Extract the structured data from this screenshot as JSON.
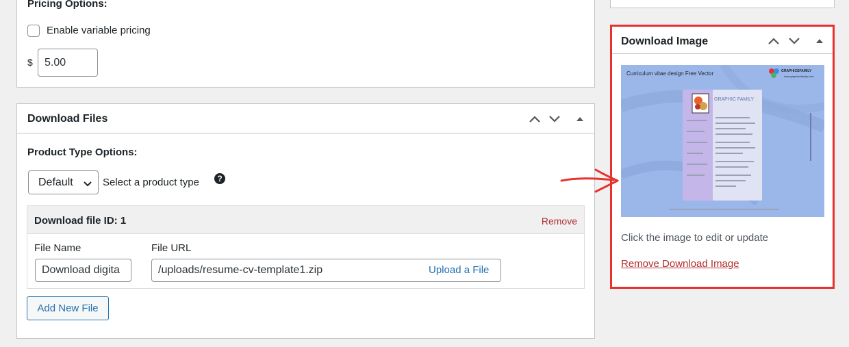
{
  "pricing": {
    "title": "Pricing Options:",
    "variable_pricing_label": "Enable variable pricing",
    "currency_symbol": "$",
    "price_value": "5.00"
  },
  "download_files": {
    "title": "Download Files",
    "product_type_label": "Product Type Options:",
    "product_type_select": "Default",
    "product_type_hint": "Select a product type",
    "file_row": {
      "header": "Download file ID: 1",
      "remove_label": "Remove",
      "file_name_label": "File Name",
      "file_name_value": "Download digita",
      "file_url_label": "File URL",
      "file_url_value": "/uploads/resume-cv-template1.zip",
      "upload_label": "Upload a File"
    },
    "add_new_label": "Add New File"
  },
  "download_image": {
    "title": "Download Image",
    "preview": {
      "title": "Curriculum vitae design Free Vector",
      "brand": "GRAPHICSFAMILY",
      "brand_url": "www.graphicsfamily.com",
      "card_name": "GRAPHIC FAMILY"
    },
    "hint": "Click the image to edit or update",
    "remove_label": "Remove Download Image"
  },
  "colors": {
    "highlight": "#e8302c",
    "link": "#2271b1",
    "danger": "#b32d2e"
  }
}
